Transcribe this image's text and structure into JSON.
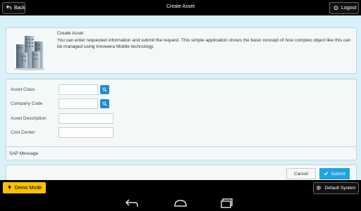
{
  "topbar": {
    "back_label": "Back",
    "title": "Create Asset",
    "logout_label": "Logout"
  },
  "header": {
    "title": "Create Asset",
    "description": "You can enter requested information and submit the request. This simple application shows the basic concept of how complex object like this can be managed using Innowera Mobile technology."
  },
  "form": {
    "asset_class": {
      "label": "Asset Class",
      "value": ""
    },
    "company_code": {
      "label": "Company Code",
      "value": ""
    },
    "asset_description": {
      "label": "Asset Description",
      "value": ""
    },
    "cost_center": {
      "label": "Cost Center",
      "value": ""
    }
  },
  "sap": {
    "label": "SAP Message"
  },
  "actions": {
    "cancel_label": "Cancel",
    "submit_label": "Submit"
  },
  "footer": {
    "demo_label": "Demo Mode",
    "system_label": "Default System"
  },
  "colors": {
    "accent": "#1ea4e0",
    "background": "#d8f1fa",
    "demo": "#fbc000"
  }
}
